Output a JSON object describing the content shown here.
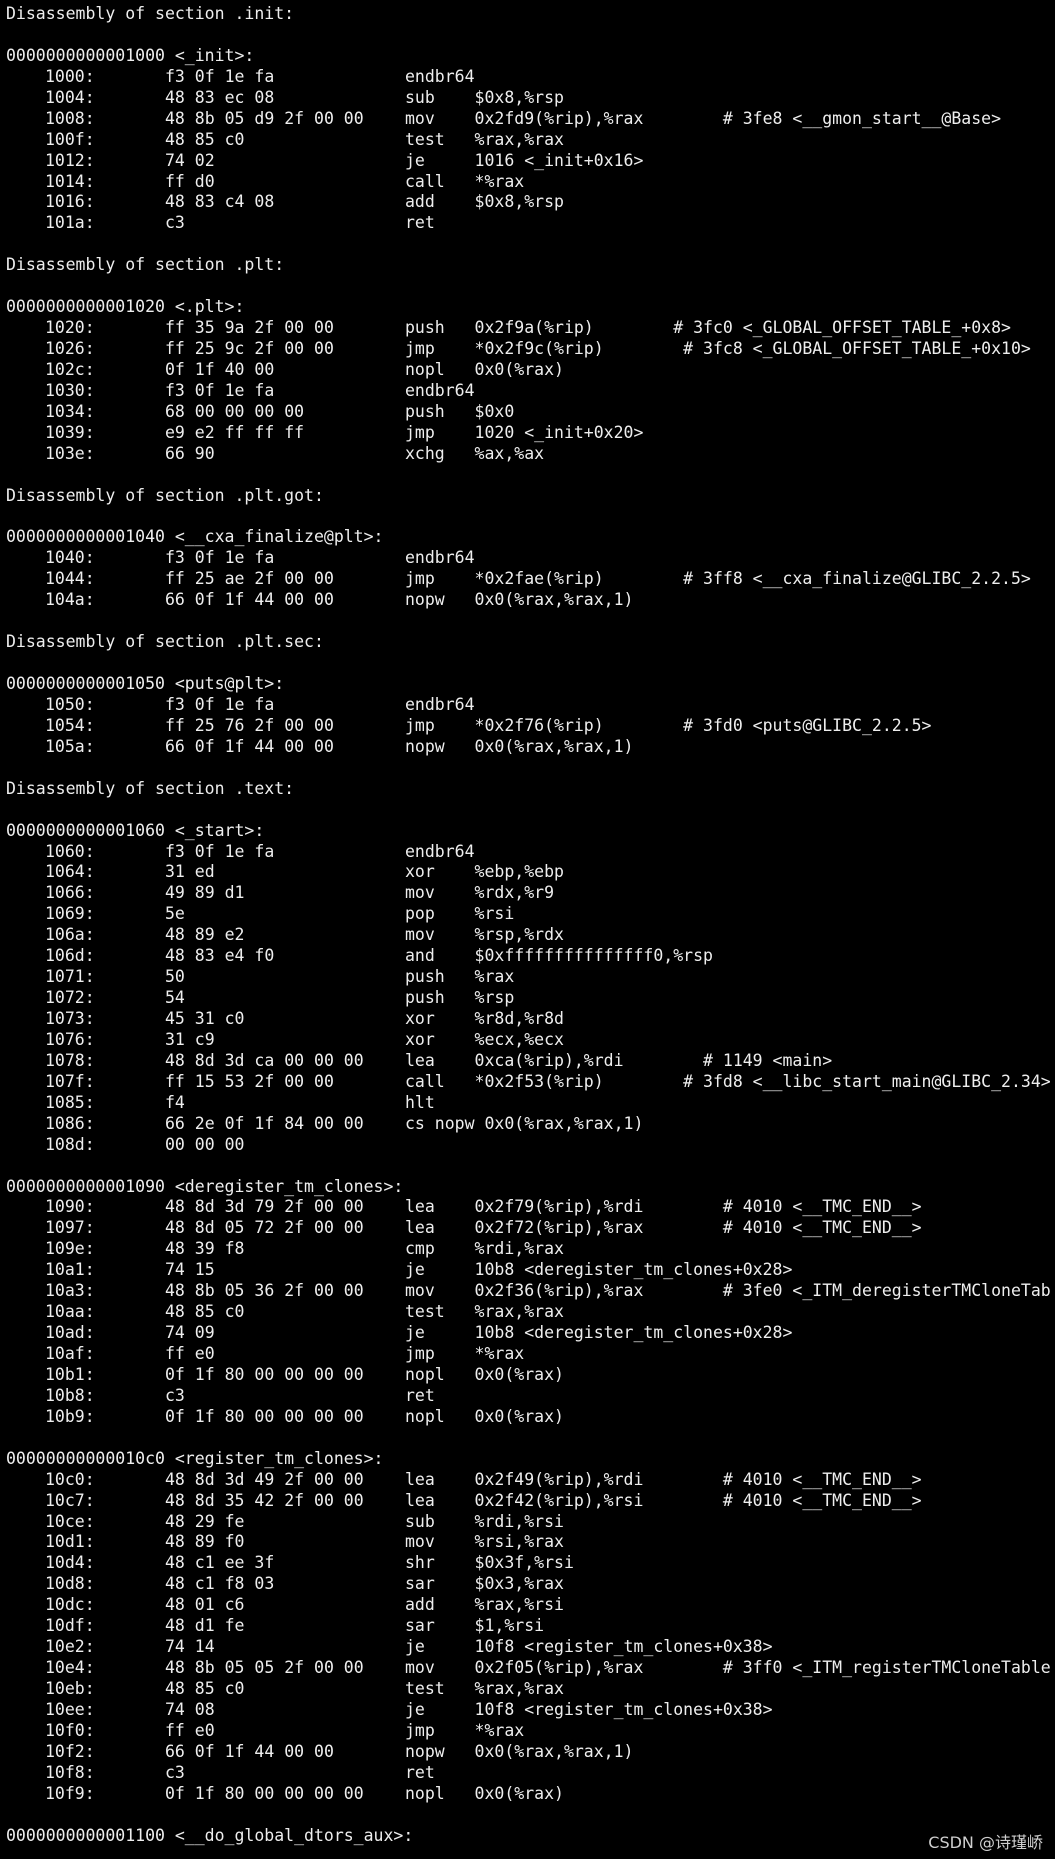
{
  "watermark": "CSDN @诗瑾峤",
  "lines": [
    {
      "text": "Disassembly of section .init:"
    },
    {
      "text": ""
    },
    {
      "text": "0000000000001000 <_init>:"
    },
    {
      "addr": "1000:",
      "bytes": "f3 0f 1e fa",
      "ins": "endbr64"
    },
    {
      "addr": "1004:",
      "bytes": "48 83 ec 08",
      "ins": "sub    $0x8,%rsp"
    },
    {
      "addr": "1008:",
      "bytes": "48 8b 05 d9 2f 00 00",
      "ins": "mov    0x2fd9(%rip),%rax        # 3fe8 <__gmon_start__@Base>"
    },
    {
      "addr": "100f:",
      "bytes": "48 85 c0",
      "ins": "test   %rax,%rax"
    },
    {
      "addr": "1012:",
      "bytes": "74 02",
      "ins": "je     1016 <_init+0x16>"
    },
    {
      "addr": "1014:",
      "bytes": "ff d0",
      "ins": "call   *%rax"
    },
    {
      "addr": "1016:",
      "bytes": "48 83 c4 08",
      "ins": "add    $0x8,%rsp"
    },
    {
      "addr": "101a:",
      "bytes": "c3",
      "ins": "ret"
    },
    {
      "text": ""
    },
    {
      "text": "Disassembly of section .plt:"
    },
    {
      "text": ""
    },
    {
      "text": "0000000000001020 <.plt>:"
    },
    {
      "addr": "1020:",
      "bytes": "ff 35 9a 2f 00 00",
      "ins": "push   0x2f9a(%rip)        # 3fc0 <_GLOBAL_OFFSET_TABLE_+0x8>"
    },
    {
      "addr": "1026:",
      "bytes": "ff 25 9c 2f 00 00",
      "ins": "jmp    *0x2f9c(%rip)        # 3fc8 <_GLOBAL_OFFSET_TABLE_+0x10>"
    },
    {
      "addr": "102c:",
      "bytes": "0f 1f 40 00",
      "ins": "nopl   0x0(%rax)"
    },
    {
      "addr": "1030:",
      "bytes": "f3 0f 1e fa",
      "ins": "endbr64"
    },
    {
      "addr": "1034:",
      "bytes": "68 00 00 00 00",
      "ins": "push   $0x0"
    },
    {
      "addr": "1039:",
      "bytes": "e9 e2 ff ff ff",
      "ins": "jmp    1020 <_init+0x20>"
    },
    {
      "addr": "103e:",
      "bytes": "66 90",
      "ins": "xchg   %ax,%ax"
    },
    {
      "text": ""
    },
    {
      "text": "Disassembly of section .plt.got:"
    },
    {
      "text": ""
    },
    {
      "text": "0000000000001040 <__cxa_finalize@plt>:"
    },
    {
      "addr": "1040:",
      "bytes": "f3 0f 1e fa",
      "ins": "endbr64"
    },
    {
      "addr": "1044:",
      "bytes": "ff 25 ae 2f 00 00",
      "ins": "jmp    *0x2fae(%rip)        # 3ff8 <__cxa_finalize@GLIBC_2.2.5>"
    },
    {
      "addr": "104a:",
      "bytes": "66 0f 1f 44 00 00",
      "ins": "nopw   0x0(%rax,%rax,1)"
    },
    {
      "text": ""
    },
    {
      "text": "Disassembly of section .plt.sec:"
    },
    {
      "text": ""
    },
    {
      "text": "0000000000001050 <puts@plt>:"
    },
    {
      "addr": "1050:",
      "bytes": "f3 0f 1e fa",
      "ins": "endbr64"
    },
    {
      "addr": "1054:",
      "bytes": "ff 25 76 2f 00 00",
      "ins": "jmp    *0x2f76(%rip)        # 3fd0 <puts@GLIBC_2.2.5>"
    },
    {
      "addr": "105a:",
      "bytes": "66 0f 1f 44 00 00",
      "ins": "nopw   0x0(%rax,%rax,1)"
    },
    {
      "text": ""
    },
    {
      "text": "Disassembly of section .text:"
    },
    {
      "text": ""
    },
    {
      "text": "0000000000001060 <_start>:"
    },
    {
      "addr": "1060:",
      "bytes": "f3 0f 1e fa",
      "ins": "endbr64"
    },
    {
      "addr": "1064:",
      "bytes": "31 ed",
      "ins": "xor    %ebp,%ebp"
    },
    {
      "addr": "1066:",
      "bytes": "49 89 d1",
      "ins": "mov    %rdx,%r9"
    },
    {
      "addr": "1069:",
      "bytes": "5e",
      "ins": "pop    %rsi"
    },
    {
      "addr": "106a:",
      "bytes": "48 89 e2",
      "ins": "mov    %rsp,%rdx"
    },
    {
      "addr": "106d:",
      "bytes": "48 83 e4 f0",
      "ins": "and    $0xfffffffffffffff0,%rsp"
    },
    {
      "addr": "1071:",
      "bytes": "50",
      "ins": "push   %rax"
    },
    {
      "addr": "1072:",
      "bytes": "54",
      "ins": "push   %rsp"
    },
    {
      "addr": "1073:",
      "bytes": "45 31 c0",
      "ins": "xor    %r8d,%r8d"
    },
    {
      "addr": "1076:",
      "bytes": "31 c9",
      "ins": "xor    %ecx,%ecx"
    },
    {
      "addr": "1078:",
      "bytes": "48 8d 3d ca 00 00 00",
      "ins": "lea    0xca(%rip),%rdi        # 1149 <main>"
    },
    {
      "addr": "107f:",
      "bytes": "ff 15 53 2f 00 00",
      "ins": "call   *0x2f53(%rip)        # 3fd8 <__libc_start_main@GLIBC_2.34>"
    },
    {
      "addr": "1085:",
      "bytes": "f4",
      "ins": "hlt"
    },
    {
      "addr": "1086:",
      "bytes": "66 2e 0f 1f 84 00 00",
      "ins": "cs nopw 0x0(%rax,%rax,1)"
    },
    {
      "addr": "108d:",
      "bytes": "00 00 00",
      "ins": ""
    },
    {
      "text": ""
    },
    {
      "text": "0000000000001090 <deregister_tm_clones>:"
    },
    {
      "addr": "1090:",
      "bytes": "48 8d 3d 79 2f 00 00",
      "ins": "lea    0x2f79(%rip),%rdi        # 4010 <__TMC_END__>"
    },
    {
      "addr": "1097:",
      "bytes": "48 8d 05 72 2f 00 00",
      "ins": "lea    0x2f72(%rip),%rax        # 4010 <__TMC_END__>"
    },
    {
      "addr": "109e:",
      "bytes": "48 39 f8",
      "ins": "cmp    %rdi,%rax"
    },
    {
      "addr": "10a1:",
      "bytes": "74 15",
      "ins": "je     10b8 <deregister_tm_clones+0x28>"
    },
    {
      "addr": "10a3:",
      "bytes": "48 8b 05 36 2f 00 00",
      "ins": "mov    0x2f36(%rip),%rax        # 3fe0 <_ITM_deregisterTMCloneTab"
    },
    {
      "addr": "10aa:",
      "bytes": "48 85 c0",
      "ins": "test   %rax,%rax"
    },
    {
      "addr": "10ad:",
      "bytes": "74 09",
      "ins": "je     10b8 <deregister_tm_clones+0x28>"
    },
    {
      "addr": "10af:",
      "bytes": "ff e0",
      "ins": "jmp    *%rax"
    },
    {
      "addr": "10b1:",
      "bytes": "0f 1f 80 00 00 00 00",
      "ins": "nopl   0x0(%rax)"
    },
    {
      "addr": "10b8:",
      "bytes": "c3",
      "ins": "ret"
    },
    {
      "addr": "10b9:",
      "bytes": "0f 1f 80 00 00 00 00",
      "ins": "nopl   0x0(%rax)"
    },
    {
      "text": ""
    },
    {
      "text": "00000000000010c0 <register_tm_clones>:"
    },
    {
      "addr": "10c0:",
      "bytes": "48 8d 3d 49 2f 00 00",
      "ins": "lea    0x2f49(%rip),%rdi        # 4010 <__TMC_END__>"
    },
    {
      "addr": "10c7:",
      "bytes": "48 8d 35 42 2f 00 00",
      "ins": "lea    0x2f42(%rip),%rsi        # 4010 <__TMC_END__>"
    },
    {
      "addr": "10ce:",
      "bytes": "48 29 fe",
      "ins": "sub    %rdi,%rsi"
    },
    {
      "addr": "10d1:",
      "bytes": "48 89 f0",
      "ins": "mov    %rsi,%rax"
    },
    {
      "addr": "10d4:",
      "bytes": "48 c1 ee 3f",
      "ins": "shr    $0x3f,%rsi"
    },
    {
      "addr": "10d8:",
      "bytes": "48 c1 f8 03",
      "ins": "sar    $0x3,%rax"
    },
    {
      "addr": "10dc:",
      "bytes": "48 01 c6",
      "ins": "add    %rax,%rsi"
    },
    {
      "addr": "10df:",
      "bytes": "48 d1 fe",
      "ins": "sar    $1,%rsi"
    },
    {
      "addr": "10e2:",
      "bytes": "74 14",
      "ins": "je     10f8 <register_tm_clones+0x38>"
    },
    {
      "addr": "10e4:",
      "bytes": "48 8b 05 05 2f 00 00",
      "ins": "mov    0x2f05(%rip),%rax        # 3ff0 <_ITM_registerTMCloneTable"
    },
    {
      "addr": "10eb:",
      "bytes": "48 85 c0",
      "ins": "test   %rax,%rax"
    },
    {
      "addr": "10ee:",
      "bytes": "74 08",
      "ins": "je     10f8 <register_tm_clones+0x38>"
    },
    {
      "addr": "10f0:",
      "bytes": "ff e0",
      "ins": "jmp    *%rax"
    },
    {
      "addr": "10f2:",
      "bytes": "66 0f 1f 44 00 00",
      "ins": "nopw   0x0(%rax,%rax,1)"
    },
    {
      "addr": "10f8:",
      "bytes": "c3",
      "ins": "ret"
    },
    {
      "addr": "10f9:",
      "bytes": "0f 1f 80 00 00 00 00",
      "ins": "nopl   0x0(%rax)"
    },
    {
      "text": ""
    },
    {
      "text": "0000000000001100 <__do_global_dtors_aux>:"
    }
  ]
}
